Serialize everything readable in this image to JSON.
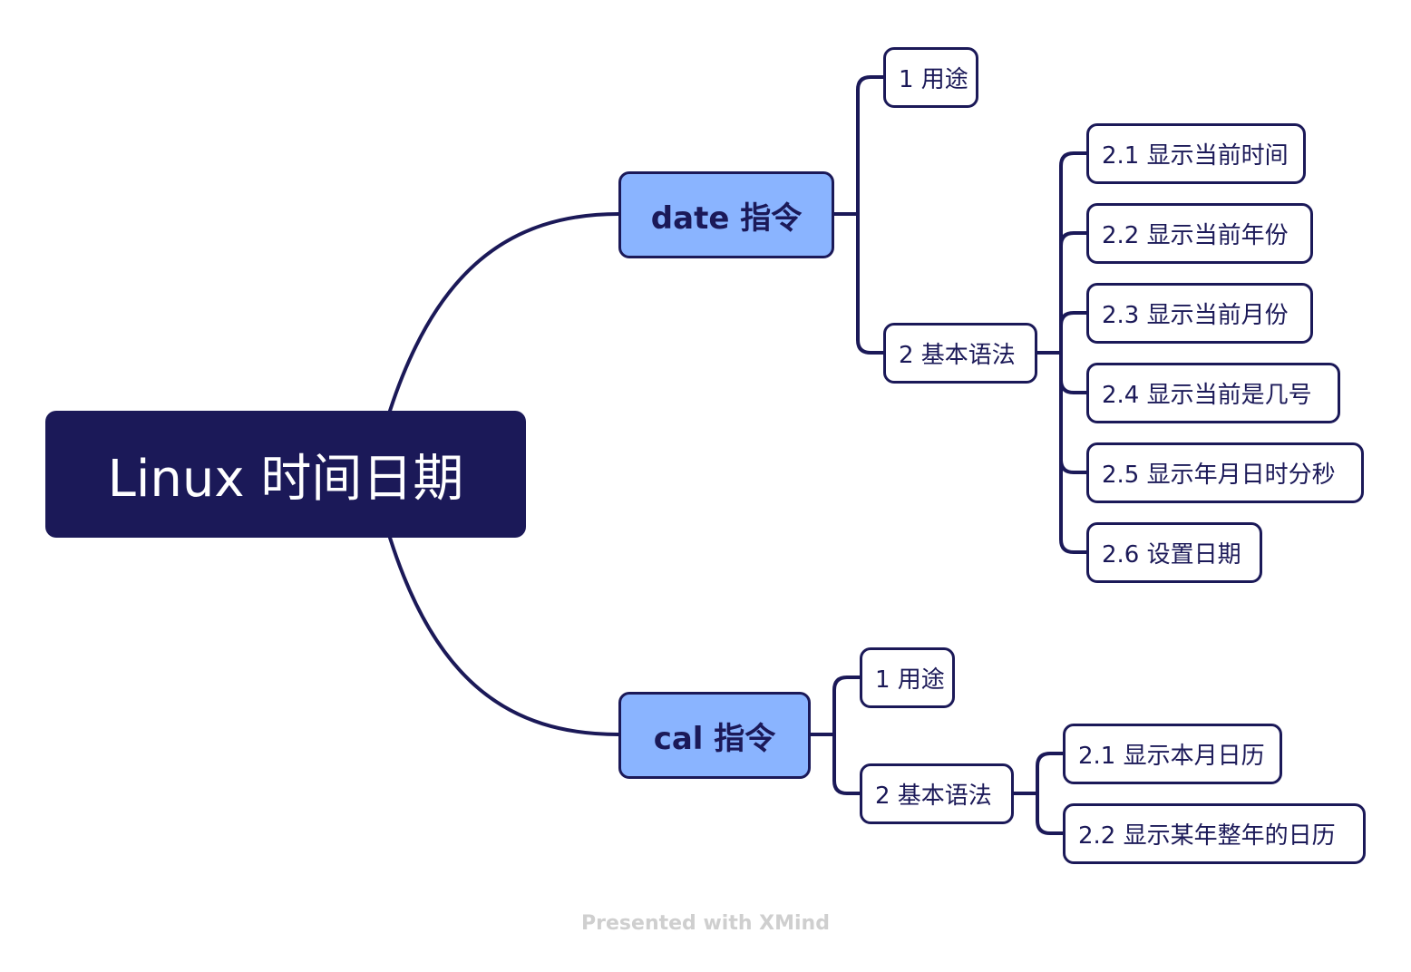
{
  "map": {
    "root": {
      "label": "Linux 时间日期"
    },
    "branches": [
      {
        "label": "date 指令",
        "children": [
          {
            "label": "1 用途"
          },
          {
            "label": "2 基本语法",
            "children": [
              {
                "label": "2.1 显示当前时间"
              },
              {
                "label": "2.2 显示当前年份"
              },
              {
                "label": "2.3 显示当前月份"
              },
              {
                "label": "2.4 显示当前是几号"
              },
              {
                "label": "2.5 显示年月日时分秒"
              },
              {
                "label": "2.6 设置日期"
              }
            ]
          }
        ]
      },
      {
        "label": "cal 指令",
        "children": [
          {
            "label": "1 用途"
          },
          {
            "label": "2 基本语法",
            "children": [
              {
                "label": "2.1 显示本月日历"
              },
              {
                "label": "2.2 显示某年整年的日历"
              }
            ]
          }
        ]
      }
    ]
  },
  "colors": {
    "root_fill": "#1b1958",
    "branch_fill": "#8ab4ff",
    "line": "#1b1958",
    "footer_text": "#cfcfcf"
  },
  "footer": {
    "text": "Presented with XMind"
  }
}
